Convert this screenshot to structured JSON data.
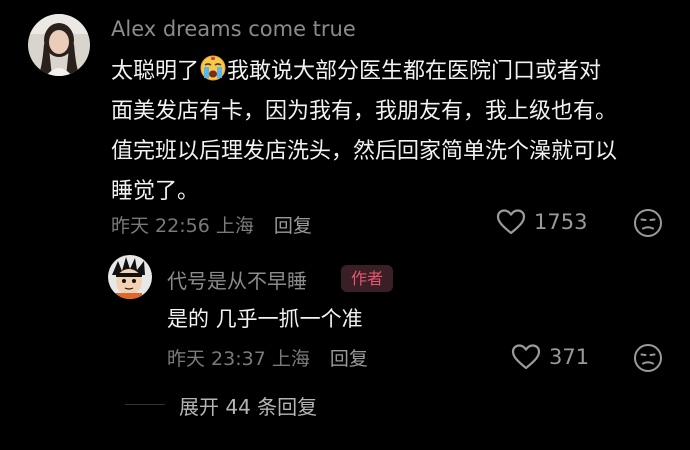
{
  "comment": {
    "username": "Alex dreams come true",
    "text_lines": [
      "太聪明了",
      "我敢说大部分医生都在医院门口或者对",
      "面美发店有卡，因为我有，我朋友有，我上级也有。",
      "值完班以后理发店洗头，然后回家简单洗个澡就可以",
      "睡觉了。"
    ],
    "emoji": "crying-face-emoji",
    "timestamp": "昨天 22:56",
    "location": "上海",
    "reply_label": "回复",
    "like_count": "1753"
  },
  "reply": {
    "username": "代号是从不早睡",
    "author_badge": "作者",
    "text": "是的 几乎一抓一个准",
    "timestamp": "昨天 23:37",
    "location": "上海",
    "reply_label": "回复",
    "like_count": "371"
  },
  "expand": {
    "label": "展开 44 条回复"
  },
  "colors": {
    "background": "#000000",
    "username": "#8b8b8b",
    "text": "#f2f2f2",
    "meta": "#7a7a7a",
    "badge_text": "#e8546f",
    "badge_bg": "#3a1f26"
  }
}
